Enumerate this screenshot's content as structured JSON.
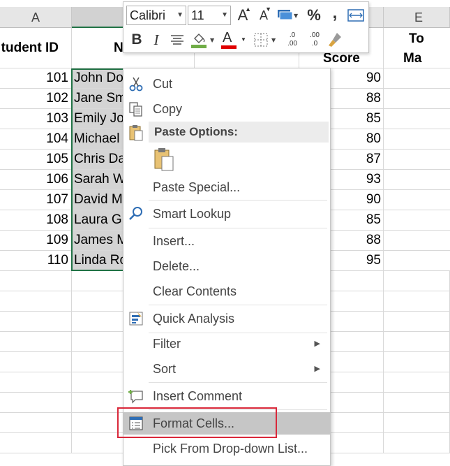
{
  "columns": {
    "a": "A",
    "e": "E"
  },
  "table_headers": {
    "student_id": "tudent ID",
    "name": "N",
    "score": "Score",
    "total_line1": "To",
    "total_line2": "Ma"
  },
  "rows": [
    {
      "id": "101",
      "name": "John Do",
      "score": "90"
    },
    {
      "id": "102",
      "name": "Jane Sm",
      "score": "88"
    },
    {
      "id": "103",
      "name": "Emily Jo",
      "score": "85"
    },
    {
      "id": "104",
      "name": "Michael",
      "score": "80"
    },
    {
      "id": "105",
      "name": "Chris Da",
      "score": "87"
    },
    {
      "id": "106",
      "name": "Sarah W",
      "score": "93"
    },
    {
      "id": "107",
      "name": "David M",
      "score": "90"
    },
    {
      "id": "108",
      "name": "Laura G",
      "score": "85"
    },
    {
      "id": "109",
      "name": "James M",
      "score": "88"
    },
    {
      "id": "110",
      "name": "Linda Ro",
      "score": "95"
    }
  ],
  "toolbar": {
    "font_name": "Calibri",
    "font_size": "11",
    "increase_font_glyph": "A",
    "decrease_font_glyph": "A",
    "percent_glyph": "%",
    "comma_glyph": ",",
    "bold_glyph": "B",
    "italic_glyph": "I",
    "font_color_glyph": "A",
    "increase_decimal": ".0 .00",
    "decrease_decimal": ".00 .0",
    "fill_color": "#70ad47",
    "font_color": "#e00000"
  },
  "menu": {
    "cut": "Cut",
    "copy": "Copy",
    "paste_options": "Paste Options:",
    "paste_special": "Paste Special...",
    "smart_lookup": "Smart Lookup",
    "insert": "Insert...",
    "delete": "Delete...",
    "clear_contents": "Clear Contents",
    "quick_analysis": "Quick Analysis",
    "filter": "Filter",
    "sort": "Sort",
    "insert_comment": "Insert Comment",
    "format_cells": "Format Cells...",
    "pick_from_list": "Pick From Drop-down List..."
  },
  "icons": {
    "cut": "scissors-icon",
    "copy": "copy-icon",
    "paste": "clipboard-icon",
    "smart_lookup": "magnifier-icon",
    "quick_analysis": "quick-analysis-icon",
    "insert_comment": "comment-icon",
    "format_cells": "format-cells-icon"
  },
  "colors": {
    "selection_border": "#217346",
    "highlight_box": "#d9283a"
  }
}
